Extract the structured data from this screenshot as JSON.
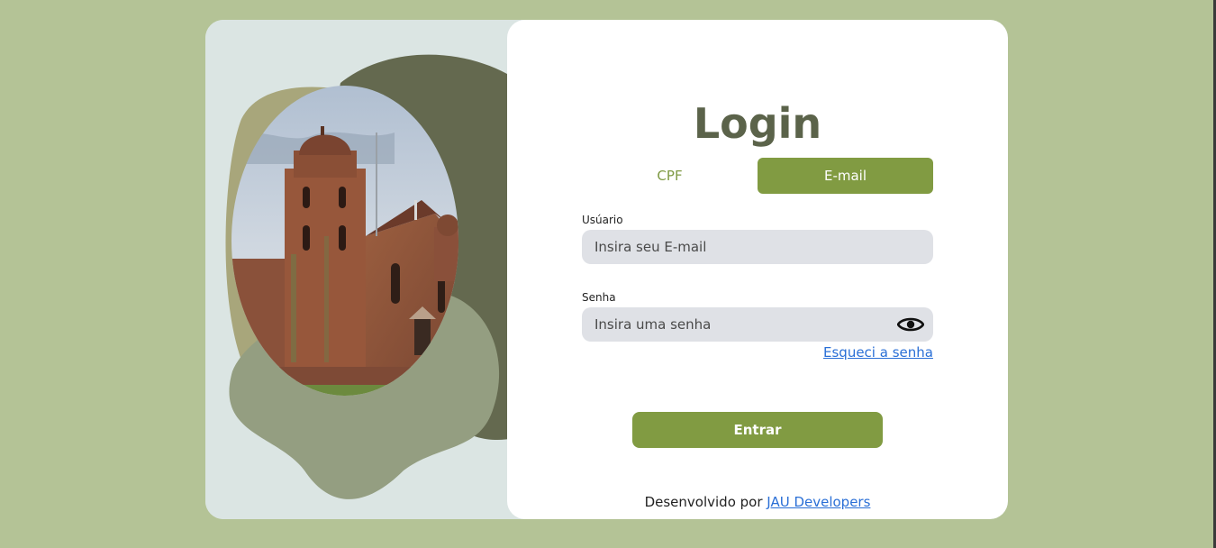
{
  "colors": {
    "page_background": "#b4c396",
    "accent": "#819b42",
    "title": "#5b634a",
    "input_background": "#dfe1e6",
    "link": "#2a6fd6"
  },
  "illustration": {
    "subject": "church-photo"
  },
  "login": {
    "title": "Login",
    "tabs": [
      {
        "label": "CPF",
        "active": false
      },
      {
        "label": "E-mail",
        "active": true
      }
    ],
    "user_label": "Usúario",
    "user_placeholder": "Insira seu E-mail",
    "password_label": "Senha",
    "password_placeholder": "Insira uma senha",
    "password_toggle_icon": "eye-icon",
    "forgot_link": "Esqueci a senha",
    "submit_label": "Entrar"
  },
  "footer": {
    "prefix": "Desenvolvido por ",
    "link": "JAU Developers"
  }
}
